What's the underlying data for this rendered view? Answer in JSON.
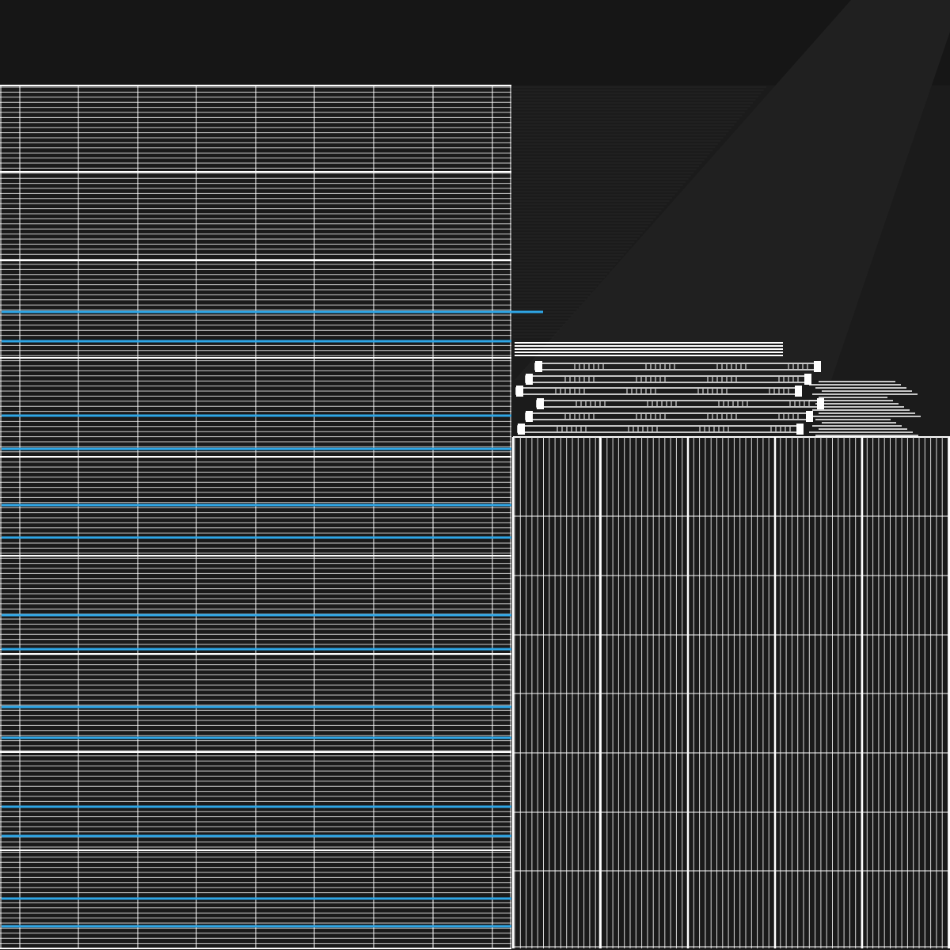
{
  "colors": {
    "background": "#1b1b1b",
    "top_band": "#161616",
    "wedge": "#202020",
    "grid_line": "#ffffff",
    "accent_line": "#2ea6e6"
  }
}
